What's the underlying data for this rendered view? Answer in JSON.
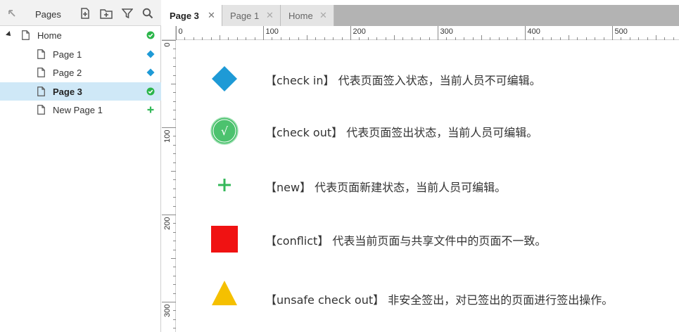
{
  "panel": {
    "title": "Pages",
    "toolbar_icons": [
      "collapse-arrow-icon",
      "add-page-icon",
      "add-folder-icon",
      "filter-icon",
      "search-icon"
    ]
  },
  "tree": {
    "items": [
      {
        "label": "Home",
        "level": 0,
        "expanded": true,
        "status": "check-out",
        "selected": false
      },
      {
        "label": "Page 1",
        "level": 1,
        "status": "check-in",
        "selected": false
      },
      {
        "label": "Page 2",
        "level": 1,
        "status": "check-in",
        "selected": false
      },
      {
        "label": "Page 3",
        "level": 1,
        "status": "check-out",
        "selected": true
      },
      {
        "label": "New Page 1",
        "level": 1,
        "status": "new",
        "selected": false
      }
    ]
  },
  "tabs": [
    {
      "label": "Page 3",
      "active": true,
      "close": "✕"
    },
    {
      "label": "Page 1",
      "active": false,
      "close": "✕"
    },
    {
      "label": "Home",
      "active": false,
      "close": "✕"
    }
  ],
  "ruler": {
    "h_labels": [
      "0",
      "100",
      "200",
      "300",
      "400",
      "500"
    ],
    "v_labels": [
      "0",
      "100",
      "200",
      "300"
    ]
  },
  "legend": {
    "items": [
      {
        "icon": "check-in-diamond-icon",
        "text": "【check in】 代表页面签入状态，当前人员不可编辑。"
      },
      {
        "icon": "check-out-circle-icon",
        "glyph": "√",
        "text": "【check out】 代表页面签出状态，当前人员可编辑。"
      },
      {
        "icon": "new-plus-icon",
        "glyph": "+",
        "text": "【new】 代表页面新建状态，当前人员可编辑。"
      },
      {
        "icon": "conflict-square-icon",
        "text": "【conflict】 代表当前页面与共享文件中的页面不一致。"
      },
      {
        "icon": "unsafe-check-out-triangle-icon",
        "text": "【unsafe check out】 非安全签出，对已签出的页面进行签出操作。"
      }
    ]
  },
  "colors": {
    "check_in": "#1e9ad6",
    "check_out": "#4cc26e",
    "new": "#35b85a",
    "conflict": "#f01212",
    "unsafe": "#f5c000",
    "selected_row": "#cfe8f7"
  }
}
